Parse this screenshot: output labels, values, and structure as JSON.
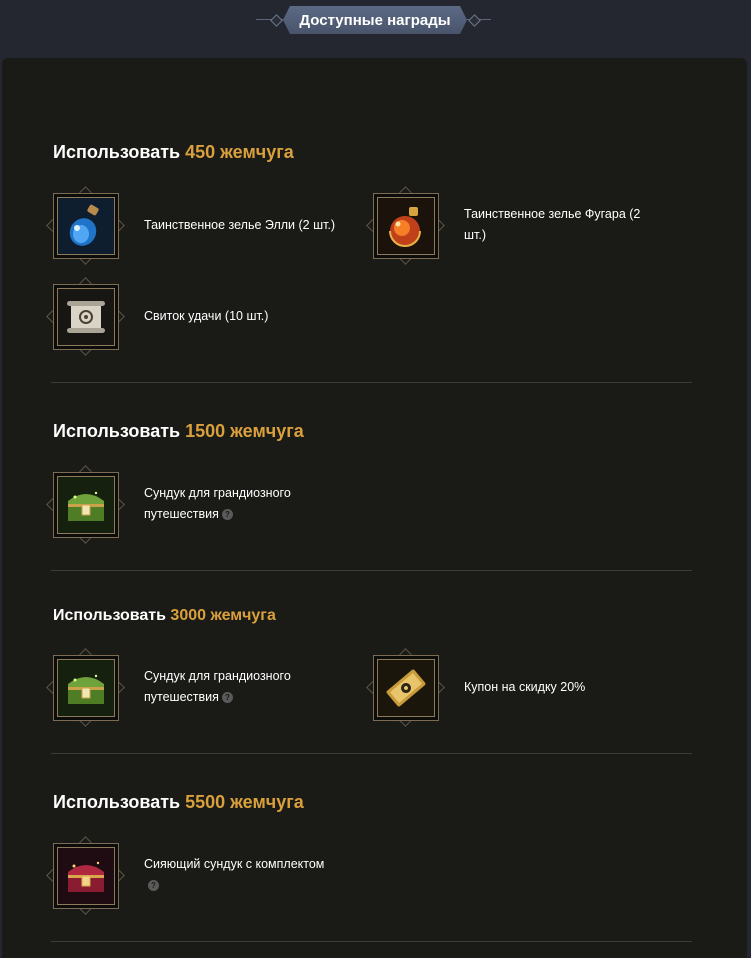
{
  "header": {
    "title": "Доступные награды"
  },
  "tiers": [
    {
      "prefix": "Использовать",
      "amount": "450 жемчуга",
      "items": [
        {
          "icon": "blue-potion-icon",
          "label": "Таинственное зелье Элли (2 шт.)",
          "has_help": false
        },
        {
          "icon": "red-potion-icon",
          "label": "Таинственное зелье Фугара (2 шт.)",
          "has_help": false
        },
        {
          "icon": "scroll-icon",
          "label": "Свиток удачи (10 шт.)",
          "has_help": false
        }
      ]
    },
    {
      "prefix": "Использовать",
      "amount": "1500 жемчуга",
      "items": [
        {
          "icon": "green-chest-icon",
          "label": "Сундук для грандиозного путешествия",
          "has_help": true
        }
      ]
    },
    {
      "prefix": "Использовать",
      "amount": "3000 жемчуга",
      "items": [
        {
          "icon": "green-chest-icon",
          "label": "Сундук для грандиозного путешествия",
          "has_help": true
        },
        {
          "icon": "coupon-icon",
          "label": "Купон на скидку 20%",
          "has_help": false
        }
      ]
    },
    {
      "prefix": "Использовать",
      "amount": "5500 жемчуга",
      "items": [
        {
          "icon": "red-chest-icon",
          "label": "Сияющий сундук с комплектом",
          "has_help": true
        }
      ]
    }
  ],
  "help_glyph": "?",
  "colors": {
    "amount": "#d9a03c",
    "background": "#1a1a16",
    "header_badge": "#55627c"
  }
}
